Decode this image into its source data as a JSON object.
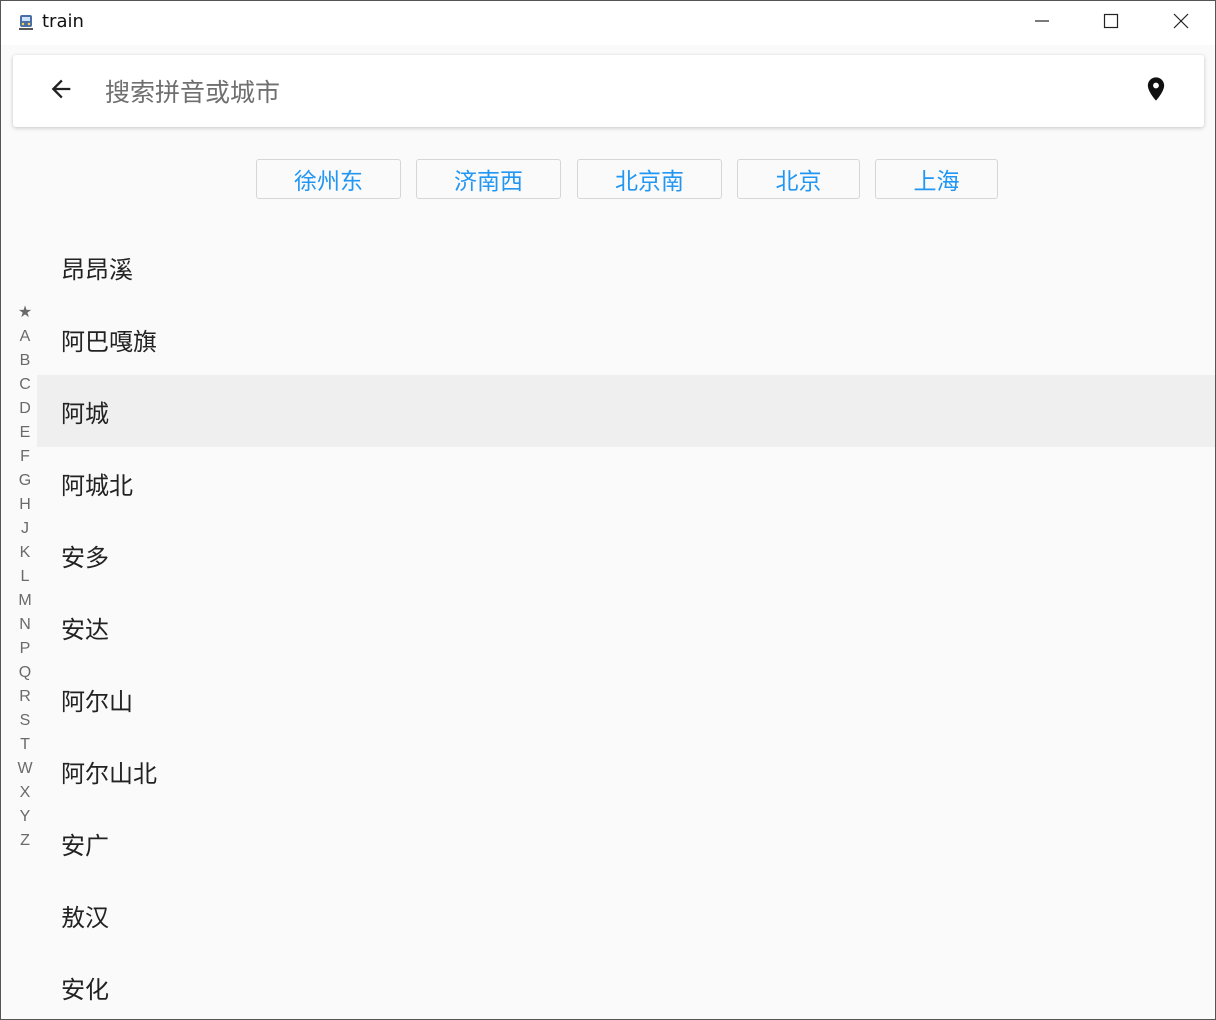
{
  "window": {
    "title": "train"
  },
  "search": {
    "placeholder": "搜索拼音或城市"
  },
  "hot_cities": [
    {
      "label": "徐州东"
    },
    {
      "label": "济南西"
    },
    {
      "label": "北京南"
    },
    {
      "label": "北京"
    },
    {
      "label": "上海"
    }
  ],
  "index_letters": [
    "★",
    "A",
    "B",
    "C",
    "D",
    "E",
    "F",
    "G",
    "H",
    "J",
    "K",
    "L",
    "M",
    "N",
    "P",
    "Q",
    "R",
    "S",
    "T",
    "W",
    "X",
    "Y",
    "Z"
  ],
  "cities": [
    {
      "name": "昂昂溪"
    },
    {
      "name": "阿巴嘎旗"
    },
    {
      "name": "阿城",
      "selected": true
    },
    {
      "name": "阿城北"
    },
    {
      "name": "安多"
    },
    {
      "name": "安达"
    },
    {
      "name": "阿尔山"
    },
    {
      "name": "阿尔山北"
    },
    {
      "name": "安广"
    },
    {
      "name": "敖汉"
    },
    {
      "name": "安化"
    }
  ],
  "colors": {
    "accent": "#2196f3",
    "selected_row": "#efefef",
    "background": "#fafafa"
  },
  "icons": {
    "back": "arrow-left-icon",
    "location": "location-pin-icon",
    "minimize": "minimize-icon",
    "maximize": "maximize-icon",
    "close": "close-icon"
  }
}
